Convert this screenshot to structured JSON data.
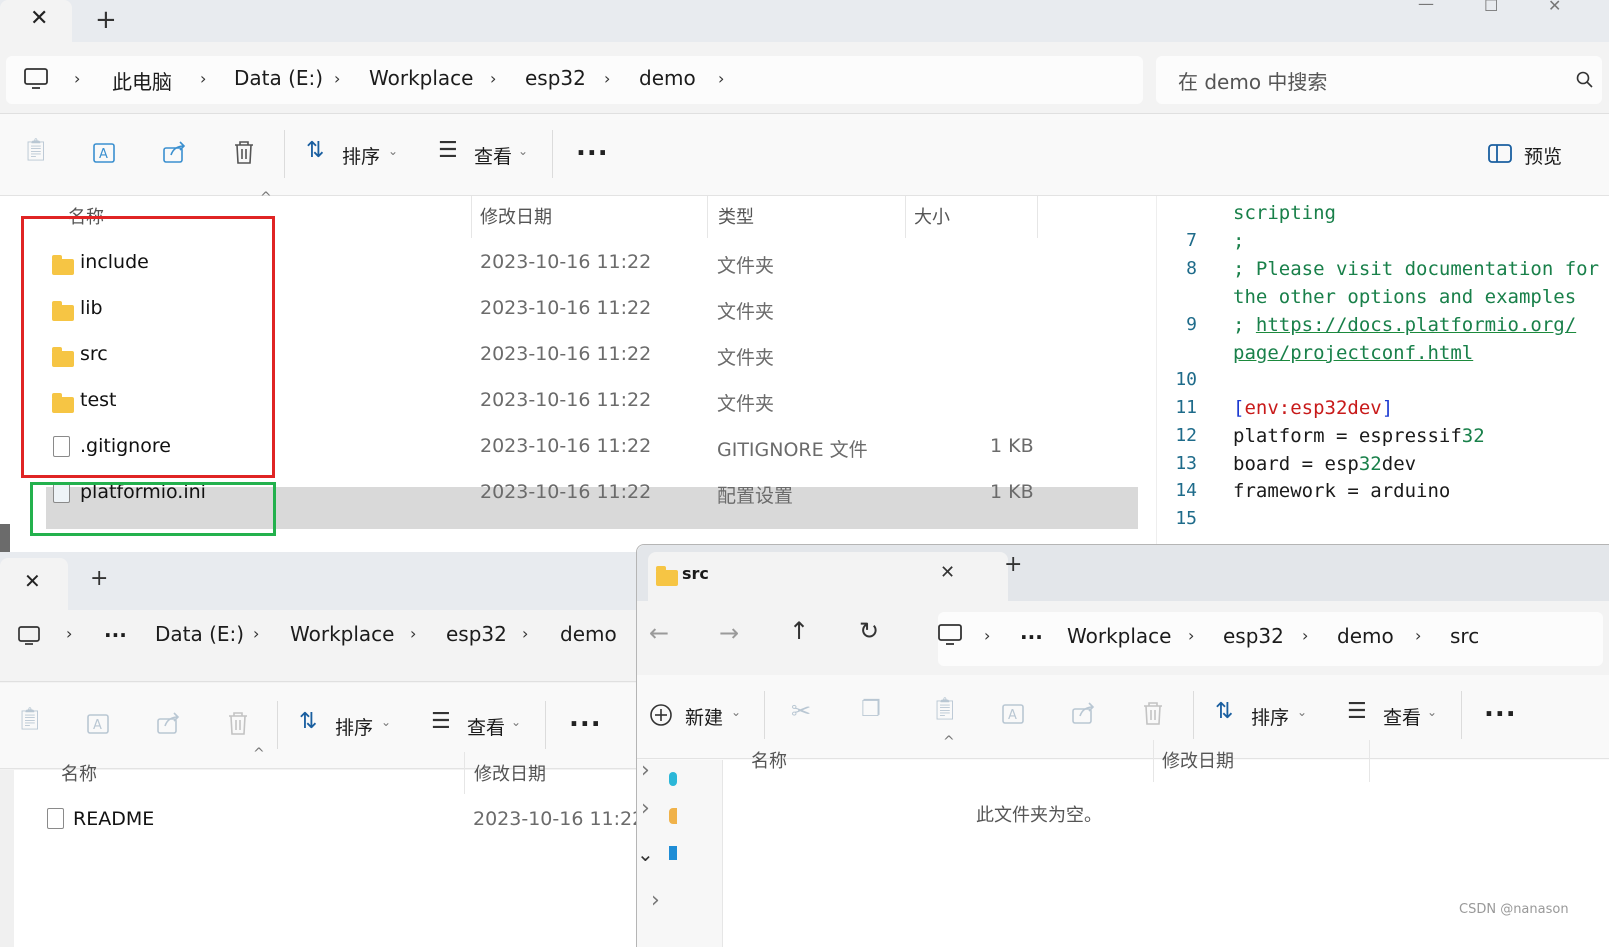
{
  "win1": {
    "address": {
      "crumbs": [
        "此电脑",
        "Data (E:)",
        "Workplace",
        "esp32",
        "demo"
      ],
      "search_placeholder": "在 demo 中搜索"
    },
    "toolbar": {
      "sort_label": "排序",
      "view_label": "查看",
      "more_label": "...",
      "preview_label": "预览"
    },
    "columns": {
      "name": "名称",
      "date": "修改日期",
      "type": "类型",
      "size": "大小"
    },
    "files": [
      {
        "name": "include",
        "date": "2023-10-16 11:22",
        "type": "文件夹",
        "size": "",
        "kind": "folder-icon"
      },
      {
        "name": "lib",
        "date": "2023-10-16 11:22",
        "type": "文件夹",
        "size": "",
        "kind": "folder-icon"
      },
      {
        "name": "src",
        "date": "2023-10-16 11:22",
        "type": "文件夹",
        "size": "",
        "kind": "folder-icon"
      },
      {
        "name": "test",
        "date": "2023-10-16 11:22",
        "type": "文件夹",
        "size": "",
        "kind": "folder-icon"
      },
      {
        "name": ".gitignore",
        "date": "2023-10-16 11:22",
        "type": "GITIGNORE 文件",
        "size": "1 KB",
        "kind": "file-icon"
      },
      {
        "name": "platformio.ini",
        "date": "2023-10-16 11:22",
        "type": "配置设置",
        "size": "1 KB",
        "kind": "config-file-icon",
        "selected": true
      }
    ],
    "preview_code": {
      "l0_text": "scripting",
      "l7_num": "7",
      "l7_text": ";",
      "l8_num": "8",
      "l8_text": "; Please visit documentation for",
      "l8b_text": "the other options and examples",
      "l9_num": "9",
      "l9_prefix": "; ",
      "l9_link1": "https://docs.platformio.org/",
      "l9_link2": "page/projectconf.html",
      "l10_num": "10",
      "l11_num": "11",
      "l11_open": "[",
      "l11_env": "env:esp32dev",
      "l11_close": "]",
      "l12_num": "12",
      "l12_key": "platform",
      "l12_eq": " = ",
      "l12_val1": "espressif",
      "l12_val2": "32",
      "l13_num": "13",
      "l13_key": "board",
      "l13_eq": " = ",
      "l13_val1": "esp",
      "l13_val2": "32",
      "l13_val3": "dev",
      "l14_num": "14",
      "l14_key": "framework",
      "l14_eq": " = ",
      "l14_val": "arduino",
      "l15_num": "15"
    }
  },
  "win2": {
    "address": {
      "crumbs": [
        "...",
        "Data (E:)",
        "Workplace",
        "esp32",
        "demo"
      ]
    },
    "toolbar": {
      "sort_label": "排序",
      "view_label": "查看",
      "more_label": "..."
    },
    "columns": {
      "name": "名称",
      "date": "修改日期"
    },
    "files": [
      {
        "name": "README",
        "date": "2023-10-16 11:22"
      }
    ]
  },
  "win3": {
    "tab_title": "src",
    "address": {
      "crumbs": [
        "...",
        "Workplace",
        "esp32",
        "demo",
        "src"
      ]
    },
    "toolbar": {
      "new_label": "新建",
      "sort_label": "排序",
      "view_label": "查看",
      "more_label": "..."
    },
    "columns": {
      "name": "名称",
      "date": "修改日期"
    },
    "empty_message": "此文件夹为空。"
  },
  "watermark": "CSDN @nanason",
  "colors": {
    "selection": "#d9d9d9",
    "red_box": "#e02424",
    "green_box": "#23b14d",
    "folder": "#f6c544"
  }
}
